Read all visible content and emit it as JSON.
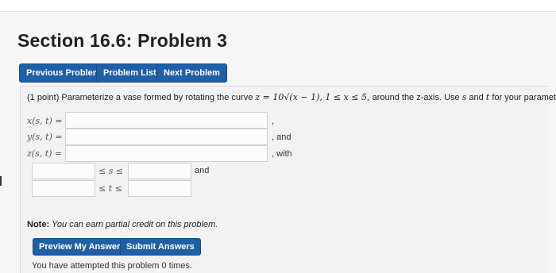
{
  "page": {
    "title": "Section 16.6: Problem 3"
  },
  "nav": {
    "previous_label": "Previous Problem",
    "list_label": "Problem List",
    "next_label": "Next Problem"
  },
  "problem": {
    "points": "(1 point)",
    "text_1": "Parameterize a vase formed by rotating the curve",
    "curve": "z = 10√(x − 1), 1 ≤ x ≤ 5,",
    "text_2": "around the z-axis. Use",
    "var_s": "s",
    "and": "and",
    "var_t": "t",
    "text_3": "for your parameters."
  },
  "answers": {
    "x_label": "x(s, t) =",
    "y_label": "y(s, t) =",
    "z_label": "z(s, t) =",
    "x_value": "",
    "y_value": "",
    "z_value": "",
    "x_after": ",",
    "y_after": ", and",
    "z_after": ", with",
    "s_lower": "",
    "s_upper": "",
    "t_lower": "",
    "t_upper": "",
    "s_ineq": "≤ s ≤",
    "t_ineq": "≤ t ≤",
    "s_after": "and"
  },
  "note": {
    "label": "Note:",
    "text": "You can earn partial credit on this problem."
  },
  "actions": {
    "preview_label": "Preview My Answers",
    "submit_label": "Submit Answers"
  },
  "status": {
    "attempts": "You have attempted this problem 0 times."
  },
  "colors": {
    "button_blue": "#1f5fa8",
    "background": "#f6f6f6",
    "panel": "#f2f2f2"
  }
}
